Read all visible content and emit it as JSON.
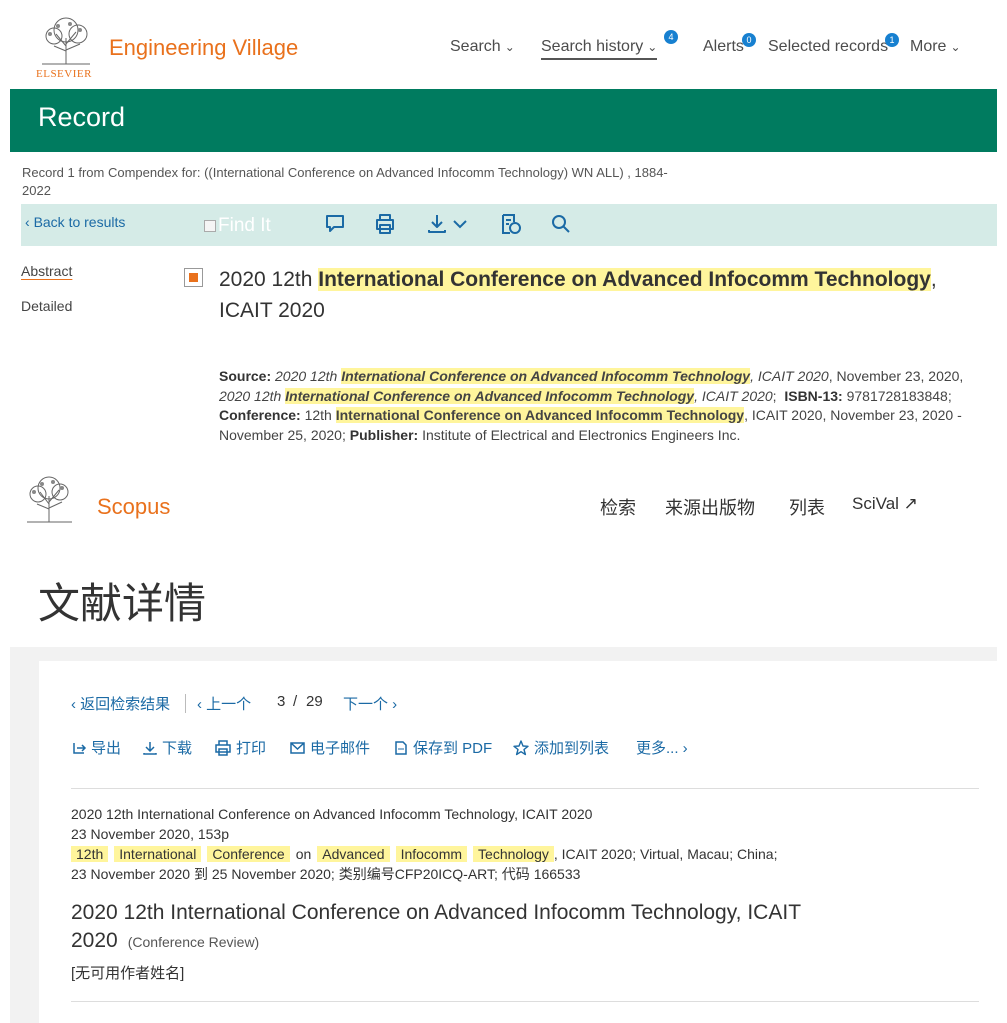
{
  "ev": {
    "elsevier_wordmark": "ELSEVIER",
    "brand": "Engineering Village",
    "nav": {
      "search": "Search",
      "search_history": "Search history",
      "search_history_badge": "4",
      "alerts": "Alerts",
      "alerts_badge": "0",
      "selected_records": "Selected records",
      "selected_records_badge": "1",
      "more": "More"
    },
    "page_title": "Record",
    "record_line": "Record 1 from Compendex for: ((International Conference on Advanced Infocomm Technology) WN ALL) , 1884-2022",
    "toolbar": {
      "back": "Back to results",
      "find_it": "Find It"
    },
    "side": {
      "abstract": "Abstract",
      "detailed": "Detailed"
    },
    "title": {
      "pre": "2020 12th ",
      "highlight": "International Conference on Advanced Infocomm Technology",
      "post": ", ICAIT 2020"
    },
    "source": {
      "label": "Source:",
      "t1": "2020 12th ",
      "hl": "International Conference on Advanced Infocomm Technology",
      "t2": ", ICAIT 2020",
      "t3": ", November 23, 2020, ",
      "t4": "2020 12th ",
      "t5": ", ICAIT 2020",
      "isbn_label": "ISBN-13:",
      "isbn": " 9781728183848; ",
      "conf_label": "Conference:",
      "conf_pre": " 12th ",
      "conf_post": ", ICAIT 2020, November 23, 2020 - November 25, 2020; ",
      "publisher_label": "Publisher:",
      "publisher": " Institute of Electrical and Electronics Engineers Inc."
    }
  },
  "scopus": {
    "brand": "Scopus",
    "nav": {
      "search": "检索",
      "sources": "来源出版物",
      "lists": "列表",
      "scival": "SciVal ↗"
    },
    "heading": "文献详情",
    "pager": {
      "back": "‹ 返回检索结果",
      "prev": "‹ 上一个",
      "current": "3",
      "slash": "/",
      "total": "29",
      "next": "下一个 ›"
    },
    "actions": {
      "export": "导出",
      "download": "下载",
      "print": "打印",
      "email": "电子邮件",
      "save_pdf": "保存到 PDF",
      "add_list": "添加到列表",
      "more": "更多... ›"
    },
    "meta": {
      "line1": "2020 12th International Conference on Advanced Infocomm Technology, ICAIT 2020",
      "line2": "23 November 2020, 153p",
      "tags": [
        "12th",
        "International",
        "Conference"
      ],
      "on": "on",
      "tags2": [
        "Advanced",
        "Infocomm",
        "Technology"
      ],
      "line3_tail": ", ICAIT 2020; Virtual, Macau; China;",
      "line4": "23 November 2020 到 25 November 2020; 类别编号CFP20ICQ-ART; 代码 166533"
    },
    "title": "2020 12th International Conference on Advanced Infocomm Technology, ICAIT 2020",
    "doc_type": "(Conference Review)",
    "authors": "[无可用作者姓名]"
  },
  "colors": {
    "ev_orange": "#e9711c",
    "ev_green": "#007b5f",
    "toolbar_bg": "#d5ebe7",
    "link_blue": "#1b6aa5",
    "highlight": "#fff59c"
  }
}
